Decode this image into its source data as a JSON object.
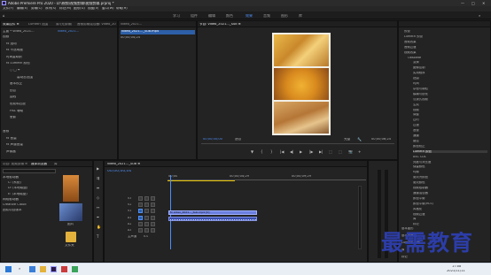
{
  "window": {
    "title": "Adobe Premiere Pro 2020 - D:\\視频\\视频剪辑\\视频剪辑.prproj *",
    "controls": [
      "—",
      "□",
      "✕"
    ]
  },
  "menu": [
    "文件(F)",
    "编辑(E)",
    "剪辑(C)",
    "序列(S)",
    "标记(M)",
    "图形(G)",
    "视图(V)",
    "窗口(W)",
    "帮助(H)"
  ],
  "workspaces": {
    "items": [
      "学习",
      "组件",
      "编辑",
      "颜色",
      "效果",
      "音频",
      "图形",
      "库"
    ],
    "active_index": 4
  },
  "effect_controls": {
    "tabs": [
      "效果控件 ≡",
      "Lumetri 范围",
      "源:(无剪辑)",
      "音频剪辑混合器: video_2021…"
    ],
    "header_left": "主要 * video_2021…",
    "header_right": "video_2021…",
    "sections": [
      {
        "label": "视频",
        "indent": 0
      },
      {
        "label": "fx 运动",
        "indent": 1
      },
      {
        "label": "fx 不透明度",
        "indent": 1
      },
      {
        "label": "时间重映射",
        "indent": 1
      },
      {
        "label": "fx Lumetri 颜色",
        "indent": 1
      },
      {
        "label": "○ □ ✒",
        "indent": 2
      },
      {
        "label": "高动态范围",
        "indent": 4
      },
      {
        "label": "基本校正",
        "indent": 2
      },
      {
        "label": "创意",
        "indent": 2
      },
      {
        "label": "曲线",
        "indent": 2
      },
      {
        "label": "色轮和匹配",
        "indent": 2
      },
      {
        "label": "HSL 辅助",
        "indent": 2
      },
      {
        "label": "晕影",
        "indent": 2
      },
      {
        "label": "音频",
        "indent": 0
      },
      {
        "label": "fx 音量",
        "indent": 1
      },
      {
        "label": "fx 声道音量",
        "indent": 1
      },
      {
        "label": "声像器",
        "indent": 1
      }
    ]
  },
  "source_mini": {
    "header": "video_2021…",
    "clip_label": "video_2021…_Sub.mp4",
    "time": "00;00;04;24"
  },
  "program": {
    "tab": "节目: video_2021…_Sub ≡",
    "timecode_left": "00;00;00;00",
    "fit": "适合",
    "quality": "完整",
    "timecode_right": "00;00;06;24",
    "controls": [
      "▼",
      "{",
      "}",
      "|◀",
      "◀|",
      "▶",
      "|▶",
      "▶|",
      "⬚",
      "⬚",
      "📷",
      "+"
    ]
  },
  "project": {
    "tabs": [
      "项目: 视频剪辑 ≡",
      "媒体浏览器",
      "库"
    ],
    "search_placeholder": "",
    "tree": [
      "本地驱动器",
      "C: (系统)",
      "D: (本地磁盘)",
      "E: (本地磁盘)",
      "网络驱动器",
      "Creative Cloud",
      "团队项目版本"
    ],
    "thumbs": [
      {
        "label": "图片",
        "color": "#c8733a"
      },
      {
        "label": "文件夹",
        "color": "#e3b23c"
      }
    ]
  },
  "timeline": {
    "tab": "video_2021…_Sub ≡",
    "timecode": "00;00;00;00",
    "ruler": [
      "00;00",
      "00;00;04;29",
      "00;00;09;29"
    ],
    "tracks": [
      {
        "name": "V3"
      },
      {
        "name": "V2"
      },
      {
        "name": "V1"
      },
      {
        "name": "A1"
      },
      {
        "name": "A2"
      },
      {
        "name": "A3"
      },
      {
        "name": "主声道",
        "value": "0.0"
      }
    ],
    "video_clip": "fx video_2021…_Sub.mp4 [V]",
    "audio_clip": ""
  },
  "effects": {
    "items": [
      "预设",
      "Lumetri 预设",
      "音频效果",
      "音频过渡",
      "视频效果",
      "Obsolete",
      "变换",
      "图像控制",
      "实用程序",
      "扭曲",
      "时间",
      "杂色与颗粒",
      "模糊与锐化",
      "沉浸式视频",
      "生成",
      "视频",
      "调整",
      "过时",
      "过渡",
      "透视",
      "通道",
      "键控",
      "颜色校正",
      "Lumetri 颜色",
      "ASC CDL",
      "亮度与对比度",
      "保留颜色",
      "均衡",
      "更改为颜色",
      "更改颜色",
      "视频限制器",
      "通道混合器",
      "颜色平衡",
      "颜色平衡(HLS)",
      "风格化",
      "视频过渡",
      "库",
      "标记"
    ],
    "highlight_index": 23,
    "subpanels": [
      "基本图形",
      "基本声音",
      "Lumetri 颜色",
      "库",
      "标记"
    ]
  },
  "taskbar": {
    "time": "17:08",
    "date": "2021/11/11"
  },
  "watermark": "最需教育"
}
